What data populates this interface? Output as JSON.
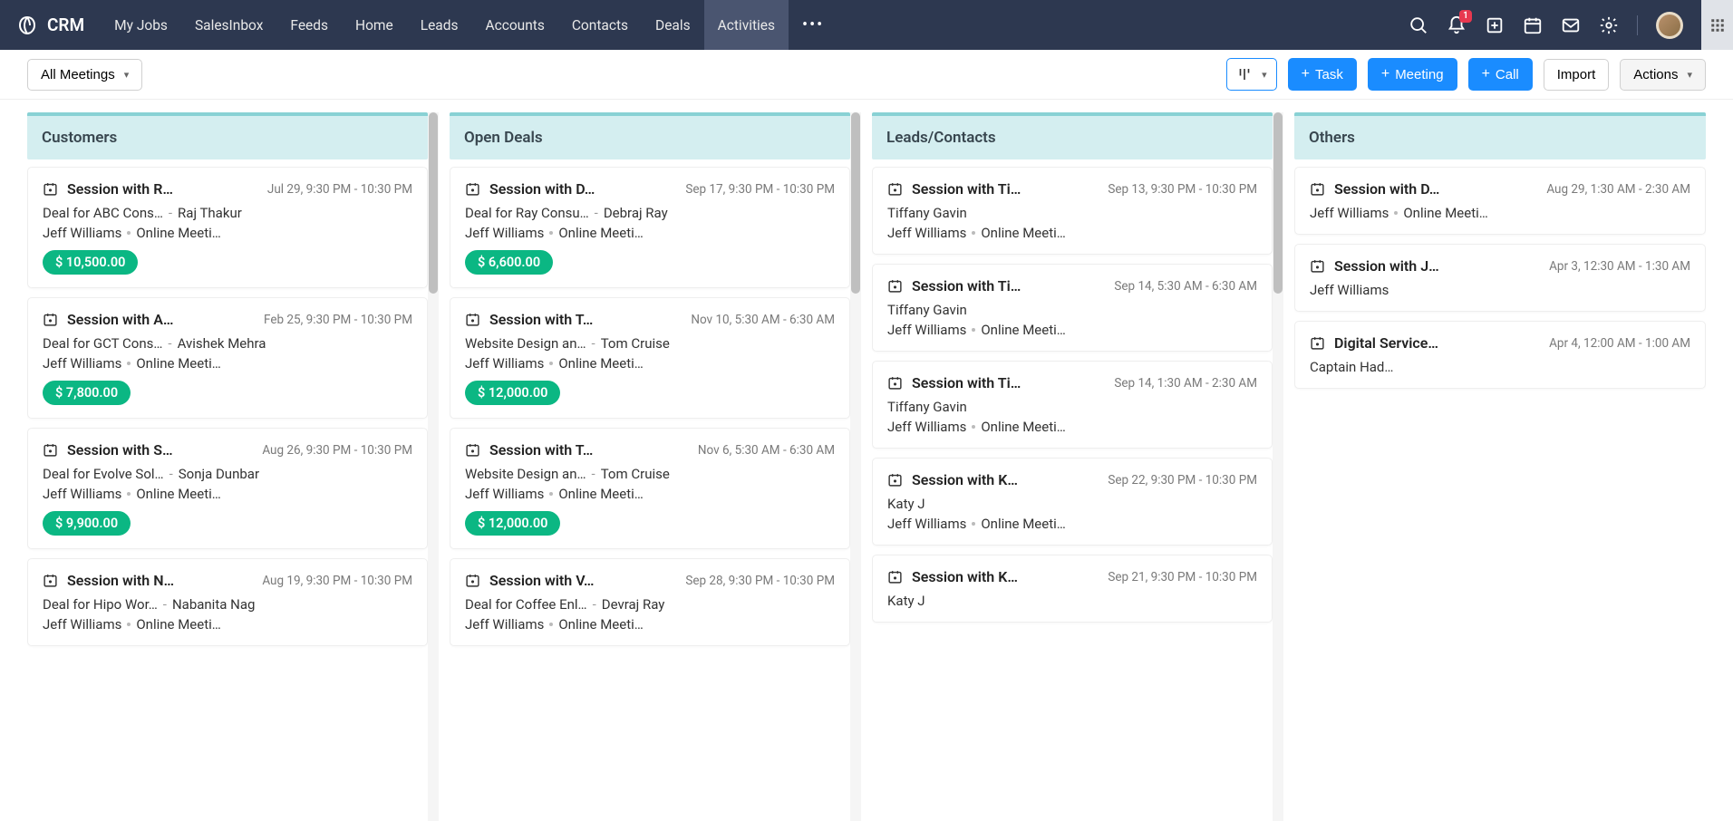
{
  "brand": "CRM",
  "nav": {
    "items": [
      "My Jobs",
      "SalesInbox",
      "Feeds",
      "Home",
      "Leads",
      "Accounts",
      "Contacts",
      "Deals",
      "Activities"
    ],
    "active_index": 8,
    "notification_count": "1"
  },
  "toolbar": {
    "view_label": "All Meetings",
    "task_btn": "Task",
    "meeting_btn": "Meeting",
    "call_btn": "Call",
    "import_btn": "Import",
    "actions_btn": "Actions"
  },
  "columns": [
    {
      "title": "Customers",
      "has_scroll": true,
      "cards": [
        {
          "title": "Session with R…",
          "time": "Jul 29, 9:30 PM - 10:30 PM",
          "line1a": "Deal for ABC Cons…",
          "line1b": "Raj Thakur",
          "owner": "Jeff Williams",
          "location": "Online Meeti…",
          "amount": "$ 10,500.00"
        },
        {
          "title": "Session with A…",
          "time": "Feb 25, 9:30 PM - 10:30 PM",
          "line1a": "Deal for GCT Cons…",
          "line1b": "Avishek Mehra",
          "owner": "Jeff Williams",
          "location": "Online Meeti…",
          "amount": "$ 7,800.00"
        },
        {
          "title": "Session with S…",
          "time": "Aug 26, 9:30 PM - 10:30 PM",
          "line1a": "Deal for Evolve Sol…",
          "line1b": "Sonja Dunbar",
          "owner": "Jeff Williams",
          "location": "Online Meeti…",
          "amount": "$ 9,900.00"
        },
        {
          "title": "Session with N…",
          "time": "Aug 19, 9:30 PM - 10:30 PM",
          "line1a": "Deal for Hipo Wor…",
          "line1b": "Nabanita Nag",
          "owner": "Jeff Williams",
          "location": "Online Meeti…"
        }
      ]
    },
    {
      "title": "Open Deals",
      "has_scroll": true,
      "cards": [
        {
          "title": "Session with D…",
          "time": "Sep 17, 9:30 PM - 10:30 PM",
          "line1a": "Deal for Ray Consu…",
          "line1b": "Debraj Ray",
          "owner": "Jeff Williams",
          "location": "Online Meeti…",
          "amount": "$ 6,600.00"
        },
        {
          "title": "Session with T…",
          "time": "Nov 10, 5:30 AM - 6:30 AM",
          "line1a": "Website Design an…",
          "line1b": "Tom Cruise",
          "owner": "Jeff Williams",
          "location": "Online Meeti…",
          "amount": "$ 12,000.00"
        },
        {
          "title": "Session with T…",
          "time": "Nov 6, 5:30 AM - 6:30 AM",
          "line1a": "Website Design an…",
          "line1b": "Tom Cruise",
          "owner": "Jeff Williams",
          "location": "Online Meeti…",
          "amount": "$ 12,000.00"
        },
        {
          "title": "Session with V…",
          "time": "Sep 28, 9:30 PM - 10:30 PM",
          "line1a": "Deal for Coffee Enl…",
          "line1b": "Devraj Ray",
          "owner": "Jeff Williams",
          "location": "Online Meeti…"
        }
      ]
    },
    {
      "title": "Leads/Contacts",
      "has_scroll": true,
      "cards": [
        {
          "title": "Session with Ti…",
          "time": "Sep 13, 9:30 PM - 10:30 PM",
          "contact": "Tiffany Gavin",
          "owner": "Jeff Williams",
          "location": "Online Meeti…"
        },
        {
          "title": "Session with Ti…",
          "time": "Sep 14, 5:30 AM - 6:30 AM",
          "contact": "Tiffany Gavin",
          "owner": "Jeff Williams",
          "location": "Online Meeti…"
        },
        {
          "title": "Session with Ti…",
          "time": "Sep 14, 1:30 AM - 2:30 AM",
          "contact": "Tiffany Gavin",
          "owner": "Jeff Williams",
          "location": "Online Meeti…"
        },
        {
          "title": "Session with K…",
          "time": "Sep 22, 9:30 PM - 10:30 PM",
          "contact": "Katy J",
          "owner": "Jeff Williams",
          "location": "Online Meeti…"
        },
        {
          "title": "Session with K…",
          "time": "Sep 21, 9:30 PM - 10:30 PM",
          "contact": "Katy J"
        }
      ]
    },
    {
      "title": "Others",
      "has_scroll": false,
      "cards": [
        {
          "title": "Session with D…",
          "time": "Aug 29, 1:30 AM - 2:30 AM",
          "owner": "Jeff Williams",
          "location": "Online Meeti…"
        },
        {
          "title": "Session with J…",
          "time": "Apr 3, 12:30 AM - 1:30 AM",
          "owner": "Jeff Williams"
        },
        {
          "title": "Digital Service…",
          "time": "Apr 4, 12:00 AM - 1:00 AM",
          "owner": "Captain Had…"
        }
      ]
    }
  ]
}
